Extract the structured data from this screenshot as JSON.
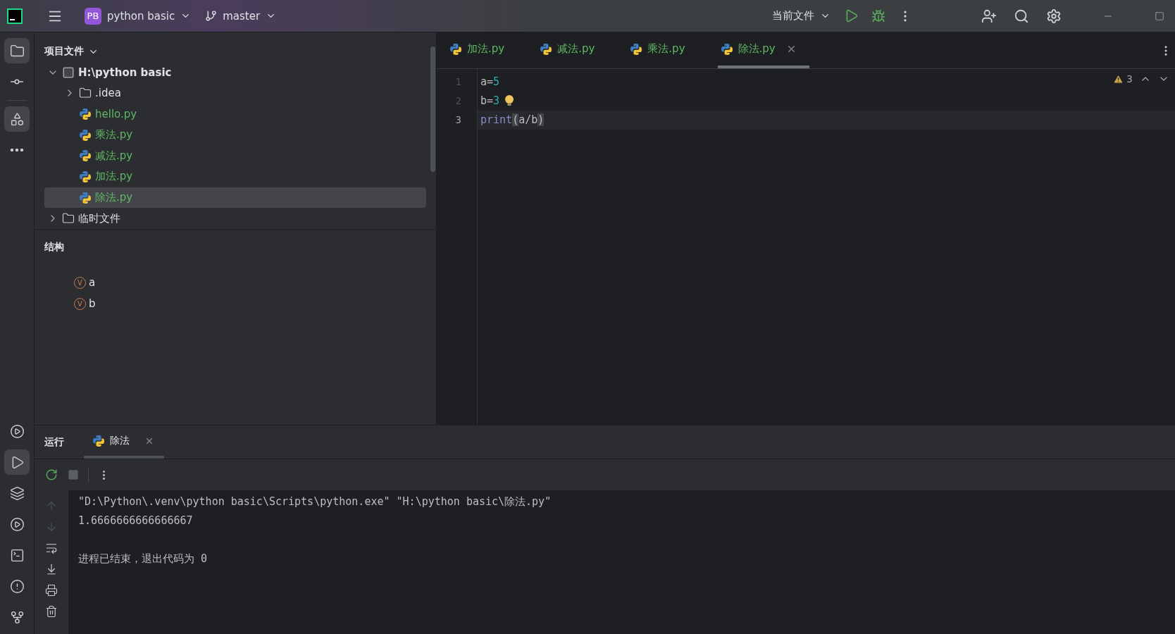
{
  "title_bar": {
    "project_badge": "PB",
    "project_name": "python basic",
    "branch": "master",
    "run_config": "当前文件"
  },
  "tool_strip": {
    "top": [
      {
        "kind": "project",
        "selected": true
      },
      {
        "kind": "commit",
        "selected": false
      },
      {
        "kind": "structure",
        "selected": true
      },
      {
        "kind": "more",
        "selected": false
      }
    ],
    "bottom": [
      {
        "kind": "python-console",
        "selected": false
      },
      {
        "kind": "run",
        "selected": true
      },
      {
        "kind": "layers",
        "selected": false
      },
      {
        "kind": "services",
        "selected": false
      },
      {
        "kind": "terminal",
        "selected": false
      },
      {
        "kind": "problems",
        "selected": false
      },
      {
        "kind": "git",
        "selected": false
      }
    ]
  },
  "project_panel": {
    "title": "项目文件",
    "tree": [
      {
        "label": "H:\\python basic",
        "kind": "root",
        "expanded": true,
        "selected": false,
        "children": [
          {
            "label": ".idea",
            "kind": "folder",
            "expanded": false,
            "selected": false
          },
          {
            "label": "hello.py",
            "kind": "python",
            "selected": false
          },
          {
            "label": "乘法.py",
            "kind": "python",
            "selected": false
          },
          {
            "label": "减法.py",
            "kind": "python",
            "selected": false
          },
          {
            "label": "加法.py",
            "kind": "python",
            "selected": false
          },
          {
            "label": "除法.py",
            "kind": "python",
            "selected": true
          }
        ]
      },
      {
        "label": "临时文件",
        "kind": "folder",
        "expanded": false,
        "selected": false
      }
    ]
  },
  "structure_panel": {
    "title": "结构",
    "items": [
      {
        "badge": "V",
        "name": "a"
      },
      {
        "badge": "V",
        "name": "b"
      }
    ]
  },
  "editor": {
    "tabs": [
      {
        "label": "加法.py",
        "selected": false
      },
      {
        "label": "减法.py",
        "selected": false
      },
      {
        "label": "乘法.py",
        "selected": false
      },
      {
        "label": "除法.py",
        "selected": true
      }
    ],
    "warnings": "3",
    "lines": [
      {
        "number": "1",
        "current": false,
        "tokens": [
          {
            "text": "a=",
            "kind": "plain"
          },
          {
            "text": "5",
            "kind": "number"
          }
        ]
      },
      {
        "number": "2",
        "current": false,
        "tokens": [
          {
            "text": "b=",
            "kind": "plain"
          },
          {
            "text": "3",
            "kind": "number"
          }
        ]
      },
      {
        "number": "3",
        "current": true,
        "tokens": [
          {
            "text": "print",
            "kind": "builtin"
          },
          {
            "text": "(",
            "kind": "bracket-match"
          },
          {
            "text": "a/b",
            "kind": "plain"
          },
          {
            "text": ")",
            "kind": "bracket-match"
          }
        ]
      }
    ]
  },
  "run_panel": {
    "title": "运行",
    "tabs": [
      {
        "label": "除法",
        "selected": true
      }
    ],
    "gutter": [
      {
        "kind": "up",
        "disabled": true
      },
      {
        "kind": "down",
        "disabled": true
      },
      {
        "kind": "wrap",
        "disabled": false
      },
      {
        "kind": "scroll-end",
        "disabled": false
      },
      {
        "kind": "print",
        "disabled": false
      },
      {
        "kind": "trash",
        "disabled": false
      }
    ],
    "output": [
      {
        "text": "\"D:\\Python\\.venv\\python basic\\Scripts\\python.exe\" \"H:\\python basic\\除法.py\"",
        "kind": "command"
      },
      {
        "text": "1.6666666666666667",
        "kind": "result"
      },
      {
        "text": "进程已结束，退出代码为 0",
        "kind": "exit"
      }
    ]
  }
}
